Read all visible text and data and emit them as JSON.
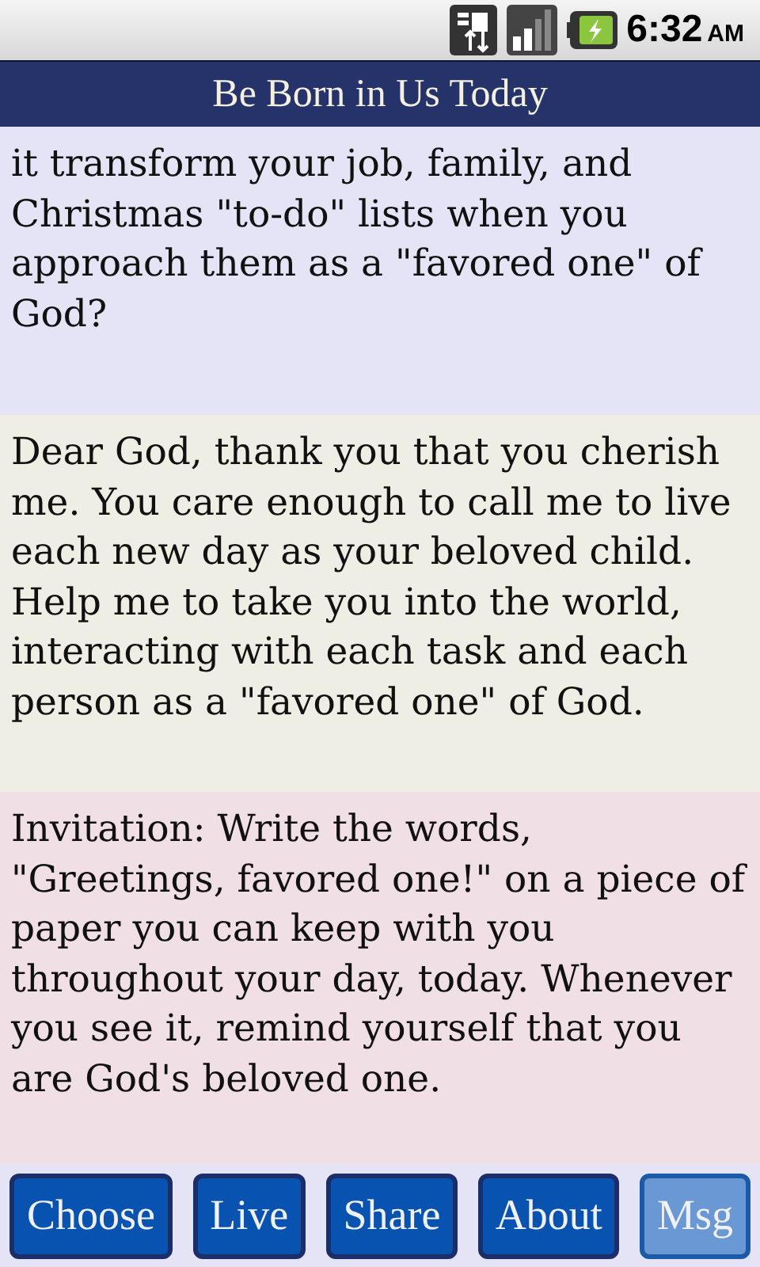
{
  "status_bar": {
    "time": "6:32",
    "meridiem": "AM"
  },
  "title": "Be Born in Us Today",
  "sections": [
    {
      "text": "it transform your job, family, and Christmas \"to-do\" lists when you approach them as a \"favored one\" of God?",
      "color": "#e4e4f6"
    },
    {
      "text": "Dear God, thank you that you cherish me. You care enough to call me to live each new day as your beloved child. Help me to take you into the world, interacting with each task and each person as a \"favored one\" of God.",
      "color": "#eeeee4"
    },
    {
      "text": "Invitation: Write the words, \"Greetings, favored one!\" on a piece of paper you can keep with you throughout your day, today. Whenever you see it, remind yourself that you are God's beloved one.",
      "color": "#f0e0e6"
    }
  ],
  "buttons": [
    {
      "label": "Choose",
      "selected": false
    },
    {
      "label": "Live",
      "selected": false
    },
    {
      "label": "Share",
      "selected": false
    },
    {
      "label": "About",
      "selected": false
    },
    {
      "label": "Msg",
      "selected": true
    }
  ]
}
